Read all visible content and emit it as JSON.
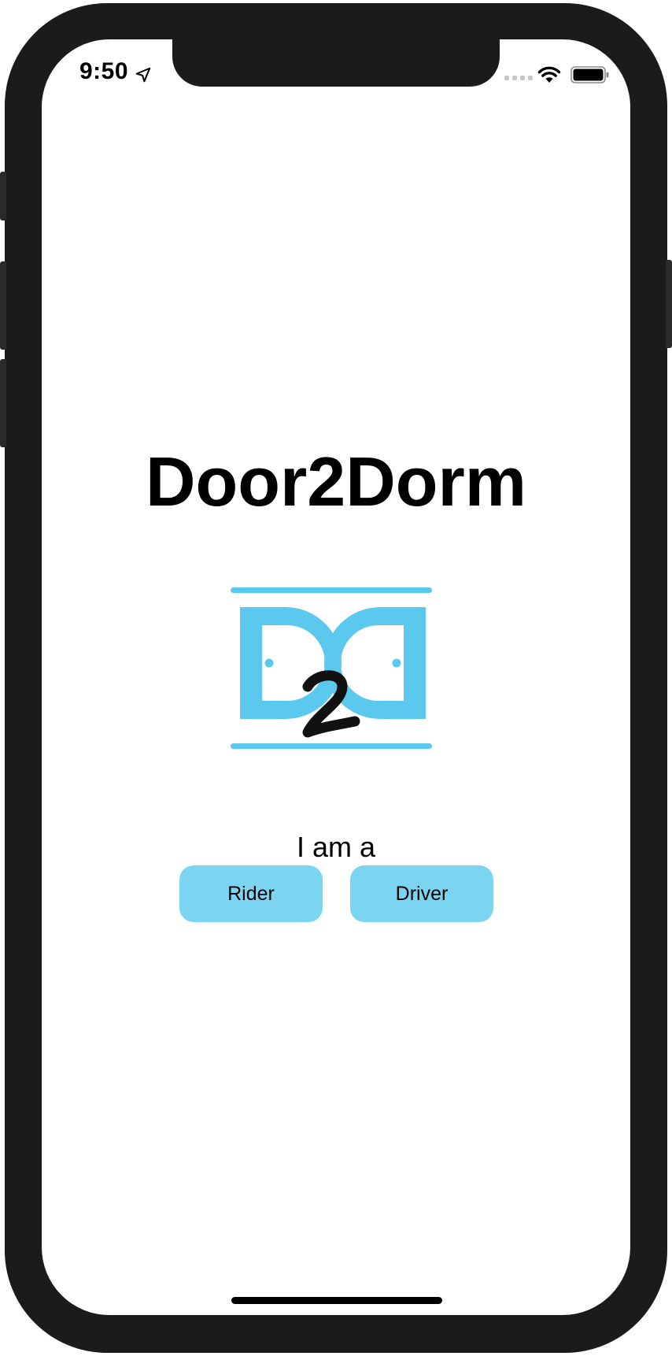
{
  "status_bar": {
    "time": "9:50",
    "location_icon": "location-arrow-icon",
    "signal_icon": "cellular-signal-icon",
    "wifi_icon": "wifi-icon",
    "battery_icon": "battery-icon"
  },
  "app": {
    "title": "Door2Dorm",
    "logo": {
      "icon": "d2d-logo",
      "lettering": "D2D",
      "accent_color": "#5bc8ee",
      "text_color": "#111111"
    }
  },
  "role_select": {
    "prompt": "I am a",
    "rider_label": "Rider",
    "driver_label": "Driver",
    "button_color": "#7bd5f1"
  }
}
